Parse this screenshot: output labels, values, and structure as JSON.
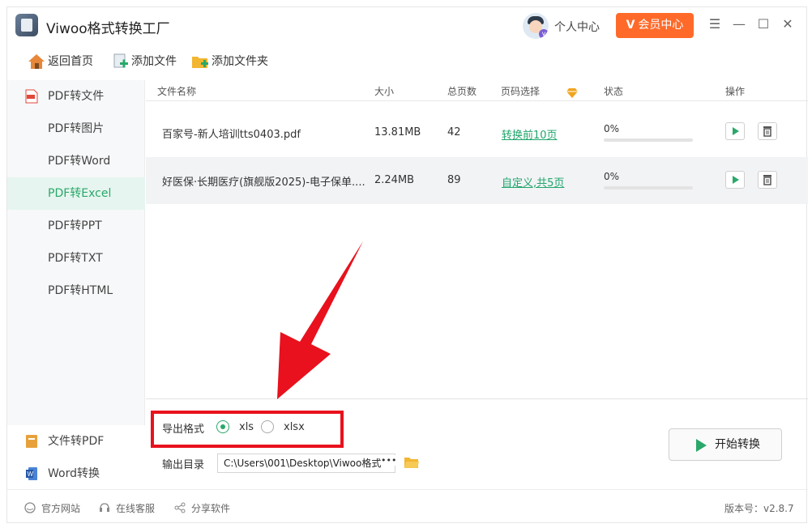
{
  "app": {
    "title": "Viwoo格式转换工厂"
  },
  "header": {
    "user_center": "个人中心",
    "vip_label": "会员中心",
    "vip_mark": "V"
  },
  "toolbar": {
    "home": "返回首页",
    "add_file": "添加文件",
    "add_folder": "添加文件夹"
  },
  "sidebar": {
    "group": "PDF转文件",
    "items": [
      "PDF转图片",
      "PDF转Word",
      "PDF转Excel",
      "PDF转PPT",
      "PDF转TXT",
      "PDF转HTML"
    ],
    "active": "PDF转Excel",
    "bottom": [
      "文件转PDF",
      "Word转换"
    ]
  },
  "table": {
    "headers": {
      "name": "文件名称",
      "size": "大小",
      "pages": "总页数",
      "page_select": "页码选择",
      "status": "状态",
      "action": "操作"
    },
    "rows": [
      {
        "name": "百家号-新人培训tts0403.pdf",
        "size": "13.81MB",
        "pages": "42",
        "page_select": "转换前10页",
        "status": "0%",
        "progress": 0
      },
      {
        "name": "好医保·长期医疗(旗舰版2025)-电子保单....",
        "size": "2.24MB",
        "pages": "89",
        "page_select": "自定义,共5页",
        "status": "0%",
        "progress": 0
      }
    ]
  },
  "export": {
    "label": "导出格式",
    "options": [
      "xls",
      "xlsx"
    ],
    "selected": "xls"
  },
  "output": {
    "label": "输出目录",
    "path": "C:\\Users\\001\\Desktop\\Viwoo格式",
    "more": "•••"
  },
  "start_button": "开始转换",
  "footer": {
    "website": "官方网站",
    "support": "在线客服",
    "share": "分享软件",
    "version": "版本号：v2.8.7"
  },
  "colors": {
    "accent": "#2aa86a",
    "vip": "#ff6a2a",
    "highlight": "#e8111d"
  }
}
